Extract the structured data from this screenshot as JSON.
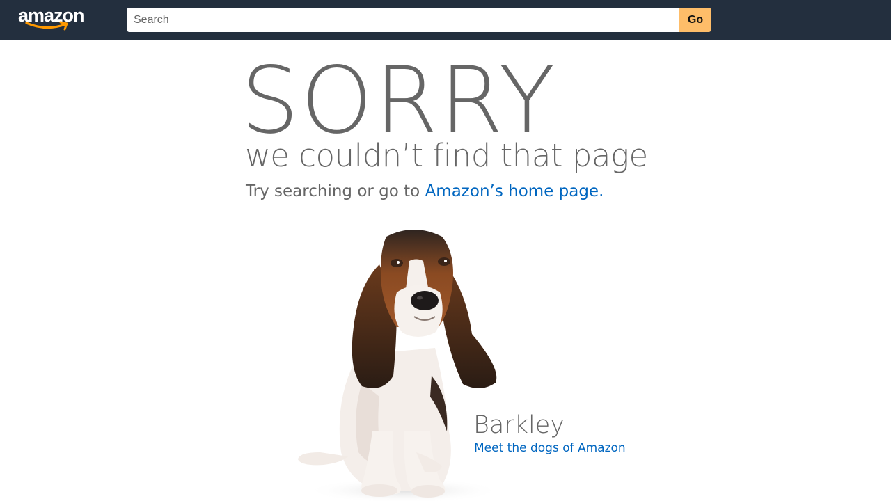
{
  "header": {
    "logo_text": "amazon",
    "search": {
      "placeholder": "Search",
      "value": ""
    },
    "go_label": "Go",
    "colors": {
      "background": "#232f3e",
      "go_button": "#febd69",
      "smile": "#ff9900"
    }
  },
  "main": {
    "headline": "SORRY",
    "subheadline": "we couldn’t find that page",
    "try_prefix": "Try searching or go to ",
    "home_link_label": "Amazon’s home page",
    "try_suffix": ".",
    "dog": {
      "name": "Barkley",
      "link_label": "Meet the dogs of Amazon"
    },
    "colors": {
      "text": "#666666",
      "link": "#0066c0"
    }
  }
}
